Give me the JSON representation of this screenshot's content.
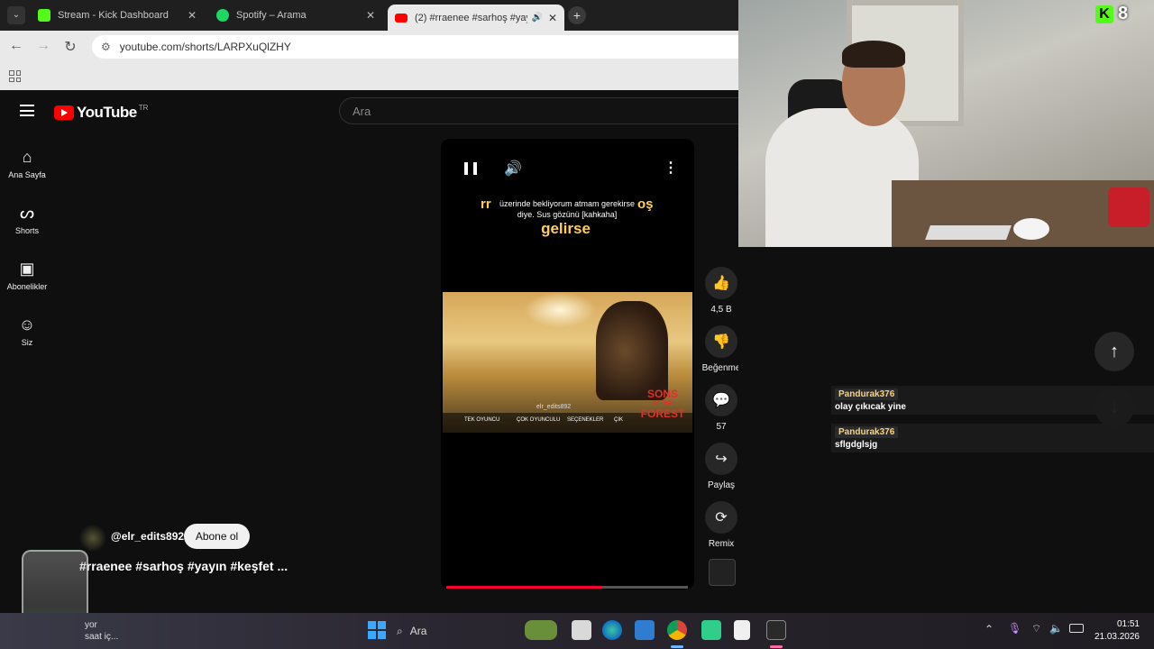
{
  "browser": {
    "tabs": [
      {
        "label": "Stream - Kick Dashboard",
        "color": "#53fc18"
      },
      {
        "label": "Spotify – Arama",
        "color": "#1ed760"
      },
      {
        "label": "(2) #rraenee #sarhoş #yayın",
        "color": "#ff0000"
      }
    ],
    "url": "youtube.com/shorts/LARPXuQlZHY"
  },
  "youtube": {
    "logo": "YouTube",
    "region": "TR",
    "search_placeholder": "Ara",
    "sidebar": [
      {
        "label": "Ana Sayfa",
        "icon": "home-icon"
      },
      {
        "label": "Shorts",
        "icon": "shorts-icon"
      },
      {
        "label": "Abonelikler",
        "icon": "subscriptions-icon"
      },
      {
        "label": "Siz",
        "icon": "you-icon"
      }
    ],
    "caption_small": "üzerinde bekliyorum atmam gerekirse diye. Sus gözünü [kahkaha]",
    "caption_big": "gelirse",
    "caption_side_left": "rr",
    "caption_side_right": "oş",
    "frame_text": {
      "watermark": "elr_edits892",
      "menu1": "TEK OYUNCU",
      "menu2": "ÇOK OYUNCULU",
      "menu3": "SEÇENEKLER",
      "menu4": "ÇIK",
      "game_title_1": "SONS",
      "game_title_2": "OF THE",
      "game_title_3": "FOREST"
    },
    "actions": {
      "like_count": "4,5 B",
      "dislike_label": "Beğenme",
      "comment_count": "57",
      "share_label": "Paylaş",
      "remix_label": "Remix"
    },
    "channel": "@elr_edits892",
    "subscribe": "Abone ol",
    "title": "#rraenee #sarhoş #yayın #keşfet ...",
    "progress": 0.64
  },
  "stream": {
    "kick_viewers": "8",
    "chat": [
      {
        "user": "Pandurak376",
        "message": "olay çıkıcak yine"
      },
      {
        "user": "Pandurak376",
        "message": "sflgdglsjg"
      }
    ]
  },
  "taskbar": {
    "search": "Ara",
    "weather_text1": "yor",
    "weather_text2": "saat iç...",
    "time": "01:51",
    "date": "21.03.2026"
  }
}
